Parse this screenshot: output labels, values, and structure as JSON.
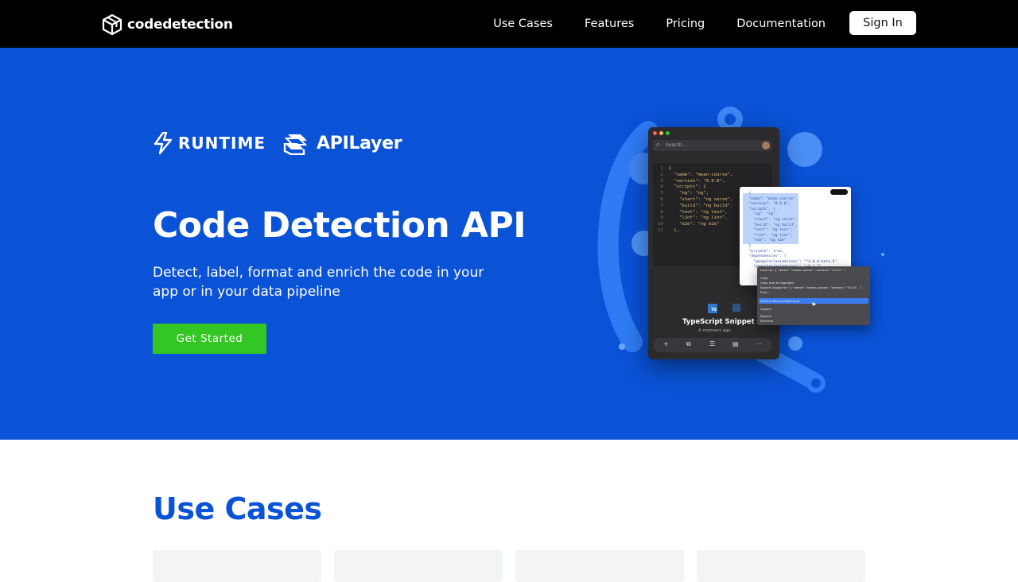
{
  "nav": {
    "brand": "codedetection",
    "links": [
      "Use Cases",
      "Features",
      "Pricing",
      "Documentation"
    ],
    "sign_in": "Sign In"
  },
  "hero": {
    "partners": [
      {
        "name": "RUNTIME",
        "icon": "lightning-bolt-icon"
      },
      {
        "name": "APILayer",
        "icon": "layers-icon"
      }
    ],
    "title": "Code Detection API",
    "subtitle": "Detect, label, format and enrich the code in your app or in your data pipeline",
    "cta": "Get Started",
    "mockup": {
      "search_placeholder": "Search...",
      "code_lines": [
        "{",
        "  \"name\": \"mean-course\",",
        "  \"version\": \"0.0.0\",",
        "  \"scripts\": {",
        "    \"ng\": \"ng\",",
        "    \"start\": \"ng serve\",",
        "    \"build\": \"ng build\",",
        "    \"test\": \"ng test\",",
        "    \"lint\": \"ng lint\",",
        "    \"e2e\": \"ng e2e\"",
        "  },"
      ],
      "snippet_label": "TypeScript Snippet",
      "snippet_time": "A moment ago",
      "doc_lines": [
        "  {",
        "  \"name\": \"mean-course\",",
        "  \"version\": \"0.0.0\",",
        "  \"scripts\": {",
        "    \"ng\": \"ng\",",
        "    \"start\": \"ng serve\",",
        "    \"build\": \"ng build\",",
        "    \"test\": \"ng test\",",
        "    \"lint\": \"ng lint\",",
        "    \"e2e\": \"ng e2e\"",
        "  },",
        "  \"private\": true,",
        "  \"dependencies\": {",
        "    \"@angular/animations\": \"^4.0.0-beta.8\",",
        "    \"@angular/animations\": \"~8.2.7\","
      ],
      "context_menu": [
        "Look Up \"{ \"name\": \"mean-course\", \"version\": \"0.0.0\"...\"",
        "Copy",
        "Copy Link to Highlight",
        "Search Google for \"{ \"name\": \"mean-course\", \"version\": \"0.0.0\"...\"",
        "Print...",
        "Send to Pieces (Selection)",
        "Inspect",
        "Speech",
        "Services"
      ]
    }
  },
  "use_cases": {
    "title": "Use Cases",
    "cards": 4
  },
  "colors": {
    "hero_bg": "#0a52d6",
    "cta_bg": "#34c724",
    "nav_bg": "#000000",
    "title_blue": "#0a52d6"
  }
}
